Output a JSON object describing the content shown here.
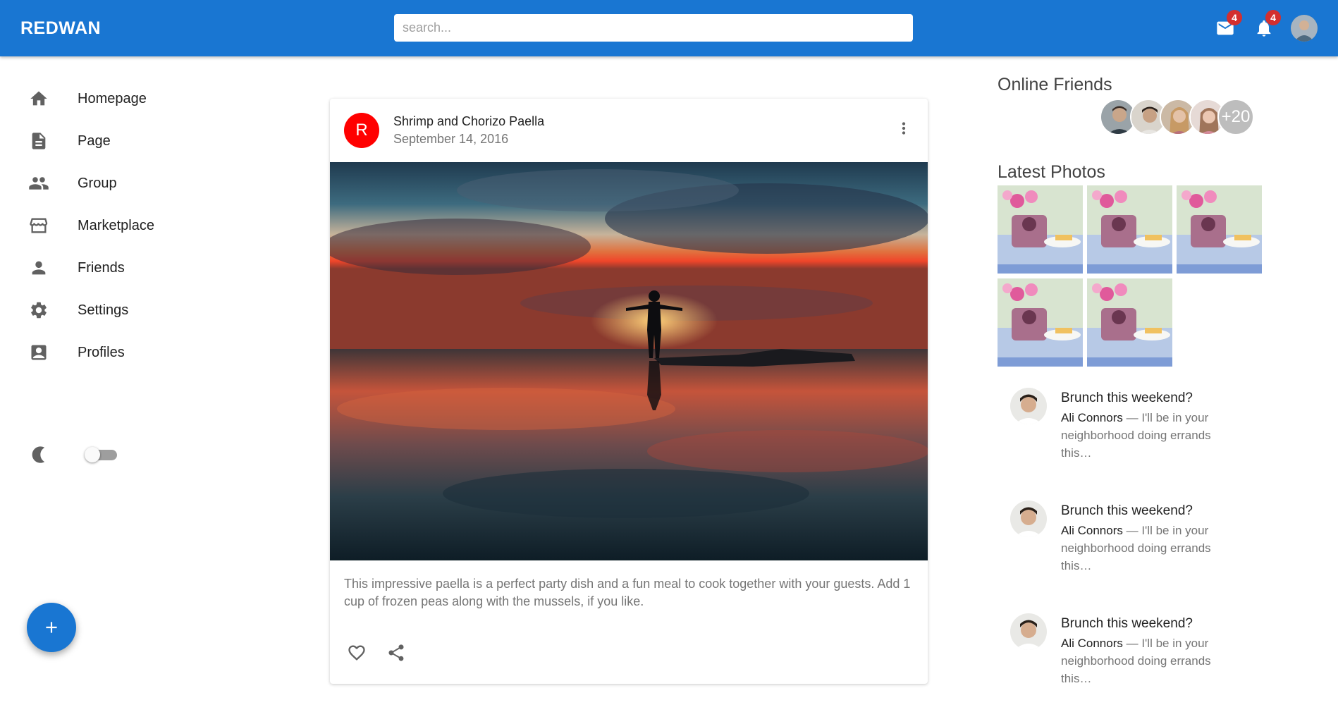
{
  "appbar": {
    "logo": "REDWAN",
    "search_placeholder": "search...",
    "mail_badge": "4",
    "notification_badge": "4",
    "color": "#1976d2"
  },
  "sidebar": {
    "items": [
      {
        "label": "Homepage",
        "icon": "home-icon"
      },
      {
        "label": "Page",
        "icon": "article-icon"
      },
      {
        "label": "Group",
        "icon": "group-icon"
      },
      {
        "label": "Marketplace",
        "icon": "storefront-icon"
      },
      {
        "label": "Friends",
        "icon": "person-icon"
      },
      {
        "label": "Settings",
        "icon": "gear-icon"
      },
      {
        "label": "Profiles",
        "icon": "account-box-icon"
      }
    ],
    "dark_mode": {
      "icon": "moon-icon",
      "enabled": false
    }
  },
  "post": {
    "avatar_letter": "R",
    "avatar_color": "#ff0000",
    "title": "Shrimp and Chorizo Paella",
    "date": "September 14, 2016",
    "body": "This impressive paella is a perfect party dish and a fun meal to cook together with your guests. Add 1 cup of frozen peas along with the mussels, if you like.",
    "actions": [
      "favorite-icon",
      "share-icon"
    ]
  },
  "rightbar": {
    "online_friends_title": "Online Friends",
    "online_friends_more": "+20",
    "latest_photos_title": "Latest Photos",
    "messages": [
      {
        "title": "Brunch this weekend?",
        "sender": "Ali Connors",
        "preview": " — I'll be in your neighborhood doing errands this…"
      },
      {
        "title": "Brunch this weekend?",
        "sender": "Ali Connors",
        "preview": " — I'll be in your neighborhood doing errands this…"
      },
      {
        "title": "Brunch this weekend?",
        "sender": "Ali Connors",
        "preview": " — I'll be in your neighborhood doing errands this…"
      }
    ]
  }
}
